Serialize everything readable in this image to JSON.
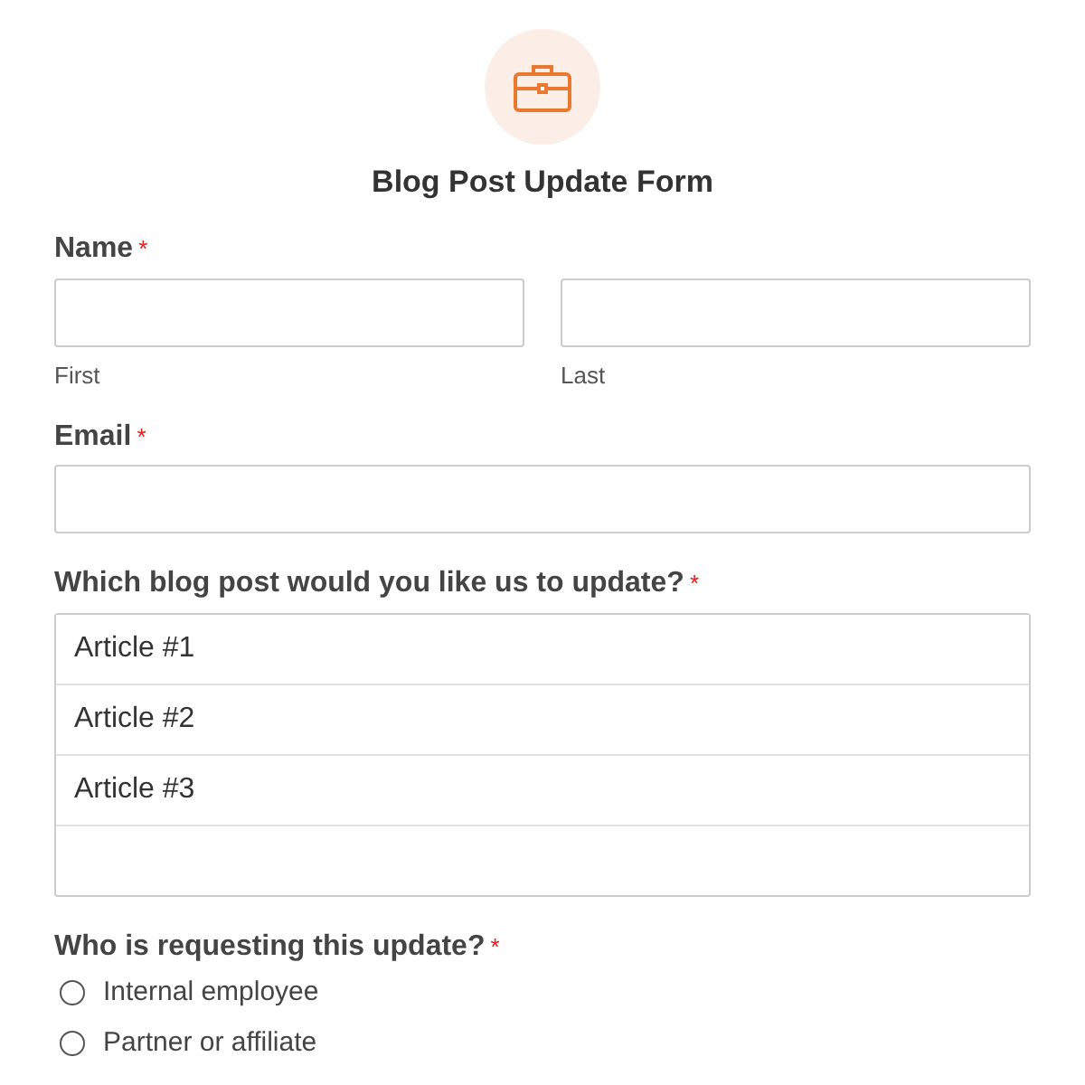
{
  "form": {
    "title": "Blog Post Update Form"
  },
  "name_field": {
    "label": "Name",
    "required_mark": "*",
    "parts": [
      {
        "sublabel": "First"
      },
      {
        "sublabel": "Last"
      }
    ]
  },
  "email_field": {
    "label": "Email",
    "required_mark": "*"
  },
  "post_field": {
    "label": "Which blog post would you like us to update?",
    "required_mark": "*",
    "options": [
      {
        "label": "Article #1",
        "selected": false
      },
      {
        "label": "Article #2",
        "selected": false
      },
      {
        "label": "Article #3",
        "selected": false
      }
    ]
  },
  "requester_field": {
    "label": "Who is requesting this update?",
    "required_mark": "*",
    "options": [
      {
        "label": "Internal employee",
        "selected": false
      },
      {
        "label": "Partner or affiliate",
        "selected": false
      }
    ]
  }
}
